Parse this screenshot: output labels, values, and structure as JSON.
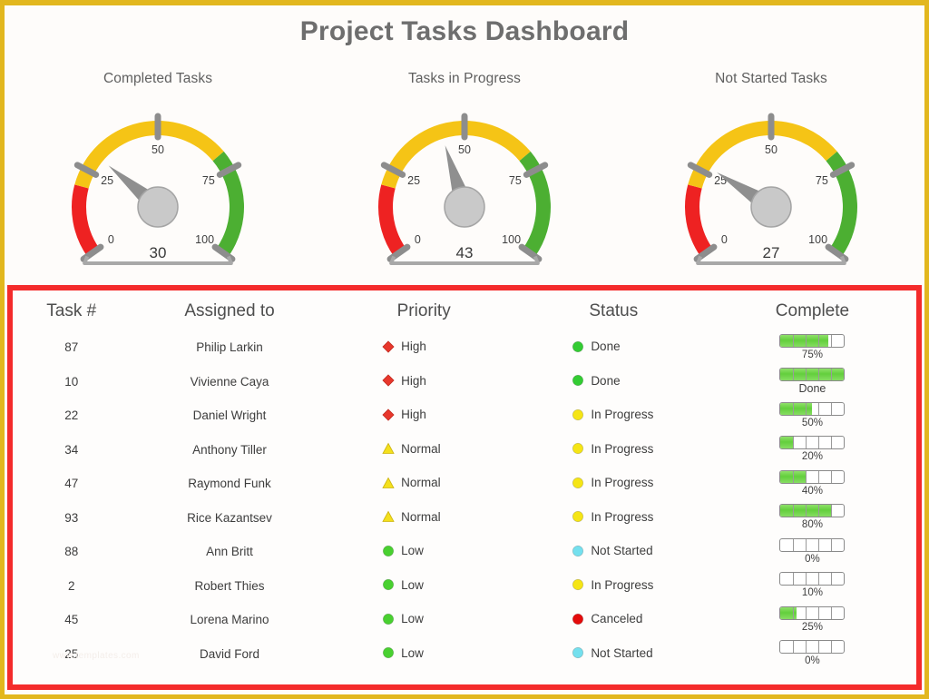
{
  "frame": {
    "outer_border_color": "#e2b71e",
    "panel_border_color": "#f42b2b",
    "background": "#fefcfa"
  },
  "header": {
    "title": "Project Tasks Dashboard",
    "title_color": "#6e6e6e"
  },
  "gauges": [
    {
      "name": "completed-tasks",
      "caption": "Completed Tasks",
      "value": 30,
      "value_text": "30",
      "min": 0,
      "max": 100,
      "ticks": [
        "0",
        "25",
        "50",
        "75",
        "100"
      ],
      "bands": [
        {
          "from": 0,
          "to": 20,
          "color": "#ee2222"
        },
        {
          "from": 20,
          "to": 70,
          "color": "#f5c416"
        },
        {
          "from": 70,
          "to": 100,
          "color": "#4caf32"
        }
      ]
    },
    {
      "name": "tasks-in-progress",
      "caption": "Tasks in Progress",
      "value": 43,
      "value_text": "43",
      "min": 0,
      "max": 100,
      "ticks": [
        "0",
        "25",
        "50",
        "75",
        "100"
      ],
      "bands": [
        {
          "from": 0,
          "to": 20,
          "color": "#ee2222"
        },
        {
          "from": 20,
          "to": 70,
          "color": "#f5c416"
        },
        {
          "from": 70,
          "to": 100,
          "color": "#4caf32"
        }
      ]
    },
    {
      "name": "not-started-tasks",
      "caption": "Not Started Tasks",
      "value": 27,
      "value_text": "27",
      "min": 0,
      "max": 100,
      "ticks": [
        "0",
        "25",
        "50",
        "75",
        "100"
      ],
      "bands": [
        {
          "from": 0,
          "to": 20,
          "color": "#ee2222"
        },
        {
          "from": 20,
          "to": 70,
          "color": "#f5c416"
        },
        {
          "from": 70,
          "to": 100,
          "color": "#4caf32"
        }
      ]
    }
  ],
  "table": {
    "columns": [
      "Task #",
      "Assigned to",
      "Priority",
      "Status",
      "Complete"
    ],
    "priority_icons": {
      "High": {
        "icon": "diamond-icon",
        "color": "#e8372c"
      },
      "Normal": {
        "icon": "triangle-icon",
        "color": "#f4e01c"
      },
      "Low": {
        "icon": "circle-icon",
        "color": "#49d030"
      }
    },
    "status_icons": {
      "Done": {
        "icon": "circle-icon",
        "color": "#33cc33"
      },
      "In Progress": {
        "icon": "circle-icon",
        "color": "#f5e515"
      },
      "Not Started": {
        "icon": "circle-icon",
        "color": "#74e0ee"
      },
      "Canceled": {
        "icon": "circle-icon",
        "color": "#e40b0b"
      }
    },
    "rows": [
      {
        "task": "87",
        "assigned": "Philip Larkin",
        "priority": "High",
        "status": "Done",
        "percent": 75,
        "complete_label": "75%"
      },
      {
        "task": "10",
        "assigned": "Vivienne Caya",
        "priority": "High",
        "status": "Done",
        "percent": 100,
        "complete_label": "Done"
      },
      {
        "task": "22",
        "assigned": "Daniel Wright",
        "priority": "High",
        "status": "In Progress",
        "percent": 50,
        "complete_label": "50%"
      },
      {
        "task": "34",
        "assigned": "Anthony Tiller",
        "priority": "Normal",
        "status": "In Progress",
        "percent": 20,
        "complete_label": "20%"
      },
      {
        "task": "47",
        "assigned": "Raymond Funk",
        "priority": "Normal",
        "status": "In Progress",
        "percent": 40,
        "complete_label": "40%"
      },
      {
        "task": "93",
        "assigned": "Rice Kazantsev",
        "priority": "Normal",
        "status": "In Progress",
        "percent": 80,
        "complete_label": "80%"
      },
      {
        "task": "88",
        "assigned": "Ann Britt",
        "priority": "Low",
        "status": "Not Started",
        "percent": 0,
        "complete_label": "0%"
      },
      {
        "task": "2",
        "assigned": "Robert Thies",
        "priority": "Low",
        "status": "In Progress",
        "percent": 0,
        "complete_label": "10%"
      },
      {
        "task": "45",
        "assigned": "Lorena Marino",
        "priority": "Low",
        "status": "Canceled",
        "percent": 25,
        "complete_label": "25%"
      },
      {
        "task": "25",
        "assigned": "David Ford",
        "priority": "Low",
        "status": "Not Started",
        "percent": 0,
        "complete_label": "0%"
      }
    ]
  },
  "watermark": "www.templates.com"
}
